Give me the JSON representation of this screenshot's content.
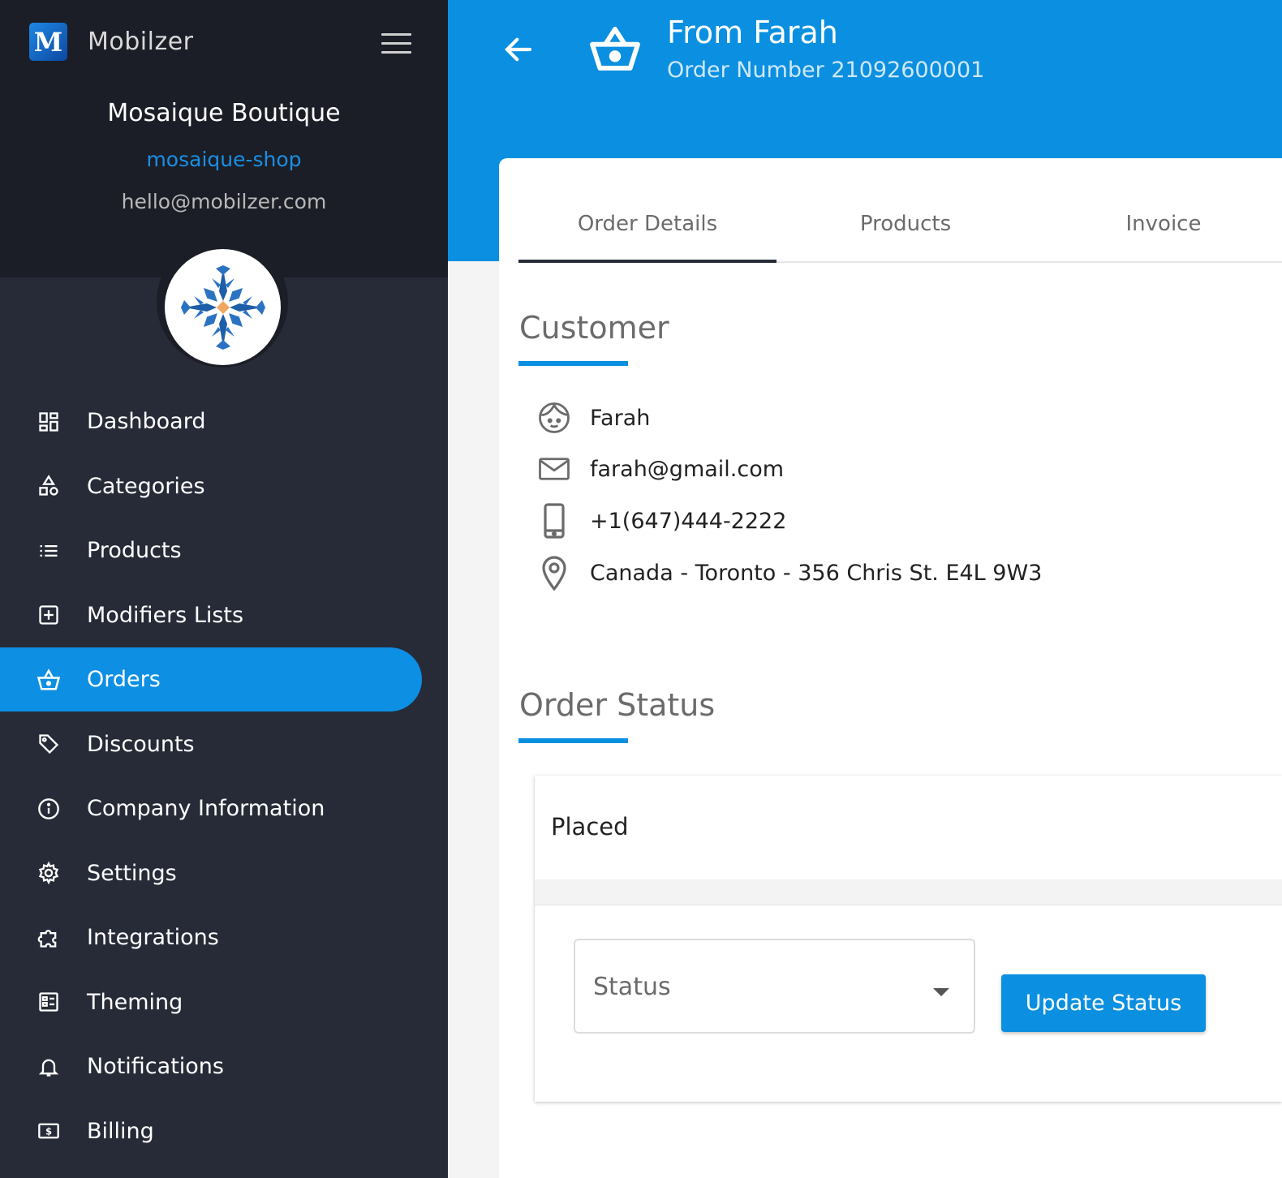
{
  "brand": {
    "name": "Mobilzer",
    "logo_letter": "M"
  },
  "store": {
    "name": "Mosaique Boutique",
    "slug": "mosaique-shop",
    "email": "hello@mobilzer.com"
  },
  "nav": {
    "items": [
      {
        "label": "Dashboard",
        "icon": "dashboard-icon"
      },
      {
        "label": "Categories",
        "icon": "shapes-icon"
      },
      {
        "label": "Products",
        "icon": "list-icon"
      },
      {
        "label": "Modifiers Lists",
        "icon": "plus-box-icon"
      },
      {
        "label": "Orders",
        "icon": "basket-icon",
        "active": true
      },
      {
        "label": "Discounts",
        "icon": "tag-icon"
      },
      {
        "label": "Company Information",
        "icon": "info-icon"
      },
      {
        "label": "Settings",
        "icon": "gear-icon"
      },
      {
        "label": "Integrations",
        "icon": "puzzle-icon"
      },
      {
        "label": "Theming",
        "icon": "theme-icon"
      },
      {
        "label": "Notifications",
        "icon": "bell-icon"
      },
      {
        "label": "Billing",
        "icon": "dollar-icon"
      }
    ]
  },
  "header": {
    "title": "From Farah",
    "subtitle": "Order Number 21092600001"
  },
  "tabs": [
    {
      "label": "Order Details",
      "active": true
    },
    {
      "label": "Products"
    },
    {
      "label": "Invoice"
    }
  ],
  "customer": {
    "section_title": "Customer",
    "name": "Farah",
    "email": "farah@gmail.com",
    "phone": "+1(647)444-2222",
    "address": "Canada - Toronto - 356 Chris St. E4L 9W3"
  },
  "order_status": {
    "section_title": "Order Status",
    "current": "Placed",
    "select_placeholder": "Status",
    "update_button": "Update Status"
  },
  "colors": {
    "accent": "#0b8fe0",
    "sidebar": "#262b37",
    "sidebar_top": "#1b1e26"
  }
}
